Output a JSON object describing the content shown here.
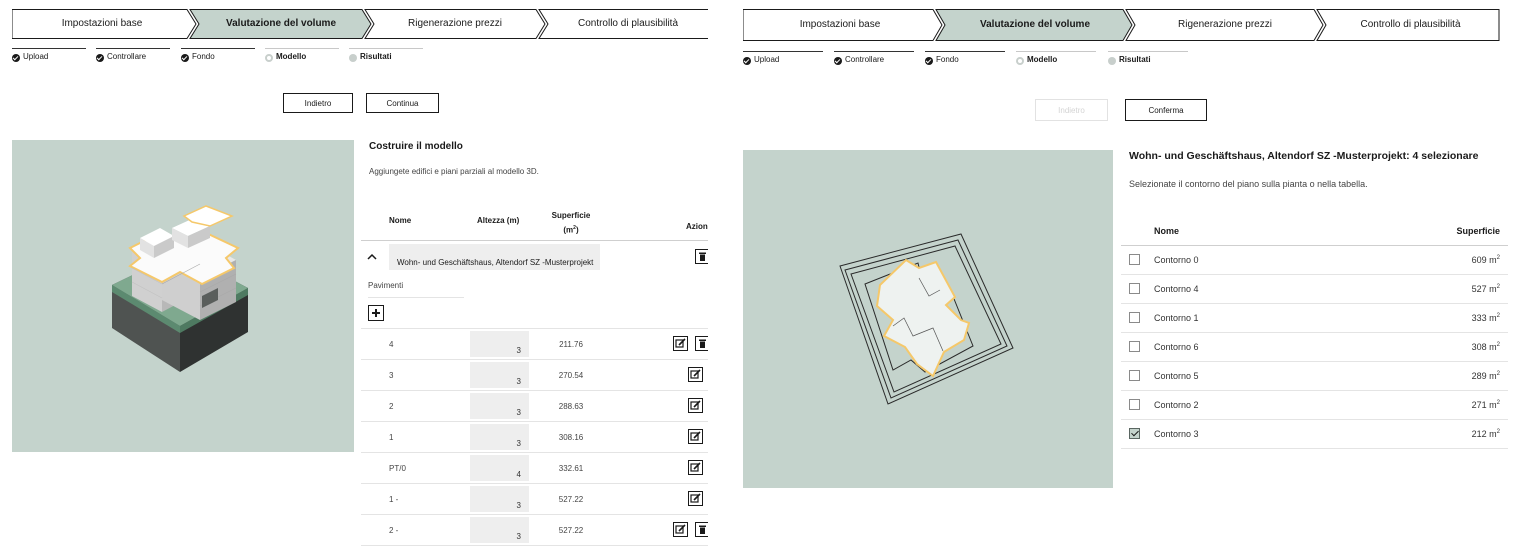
{
  "left_panel": {
    "wizard_steps": [
      "Impostazioni base",
      "Valutazione del volume",
      "Rigenerazione prezzi",
      "Controllo di plausibilità"
    ],
    "sub_steps": [
      "Upload",
      "Controllare",
      "Fondo",
      "Modello",
      "Risultati"
    ],
    "back_label": "Indietro",
    "continue_label": "Continua",
    "title": "Costruire il modello",
    "description": "Aggiungete edifici e piani parziali al modello 3D.",
    "columns": {
      "name": "Nome",
      "height": "Altezza (m)",
      "area_line1": "Superficie",
      "area_unit": "(m",
      "area_sup": "2",
      "area_close": ")",
      "actions": "Azioni"
    },
    "collapse_icon": "chevron-up-icon",
    "building_name": "Wohn- und Geschäftshaus, Altendorf SZ -Musterprojekt",
    "floors_label": "Pavimenti",
    "add_icon": "plus-icon",
    "floors": [
      {
        "name": "4",
        "height": "3",
        "area": "211.76"
      },
      {
        "name": "3",
        "height": "3",
        "area": "270.54"
      },
      {
        "name": "2",
        "height": "3",
        "area": "288.63"
      },
      {
        "name": "1",
        "height": "3",
        "area": "308.16"
      },
      {
        "name": "PT/0",
        "height": "4",
        "area": "332.61"
      },
      {
        "name": "1 -",
        "height": "3",
        "area": "527.22"
      },
      {
        "name": "2 -",
        "height": "3",
        "area": "527.22"
      }
    ]
  },
  "right_panel": {
    "wizard_steps": [
      "Impostazioni base",
      "Valutazione del volume",
      "Rigenerazione prezzi",
      "Controllo di plausibilità"
    ],
    "sub_steps": [
      "Upload",
      "Controllare",
      "Fondo",
      "Modello",
      "Risultati"
    ],
    "back_label": "Indietro",
    "confirm_label": "Conferma",
    "title": "Wohn- und Geschäftshaus, Altendorf SZ -Musterprojekt: 4 selezionare",
    "description": "Selezionate il contorno del piano sulla pianta o nella tabella.",
    "columns": {
      "name": "Nome",
      "area": "Superficie"
    },
    "area_unit": "m",
    "area_sup": "2",
    "contours": [
      {
        "name": "Contorno 0",
        "area": "609",
        "checked": false
      },
      {
        "name": "Contorno 4",
        "area": "527",
        "checked": false
      },
      {
        "name": "Contorno 1",
        "area": "333",
        "checked": false
      },
      {
        "name": "Contorno 6",
        "area": "308",
        "checked": false
      },
      {
        "name": "Contorno 5",
        "area": "289",
        "checked": false
      },
      {
        "name": "Contorno 2",
        "area": "271",
        "checked": false
      },
      {
        "name": "Contorno 3",
        "area": "212",
        "checked": true
      }
    ]
  },
  "colors": {
    "accent": "#c4d3cc",
    "site": "#7fa98f",
    "highlight": "#f5c86a"
  }
}
